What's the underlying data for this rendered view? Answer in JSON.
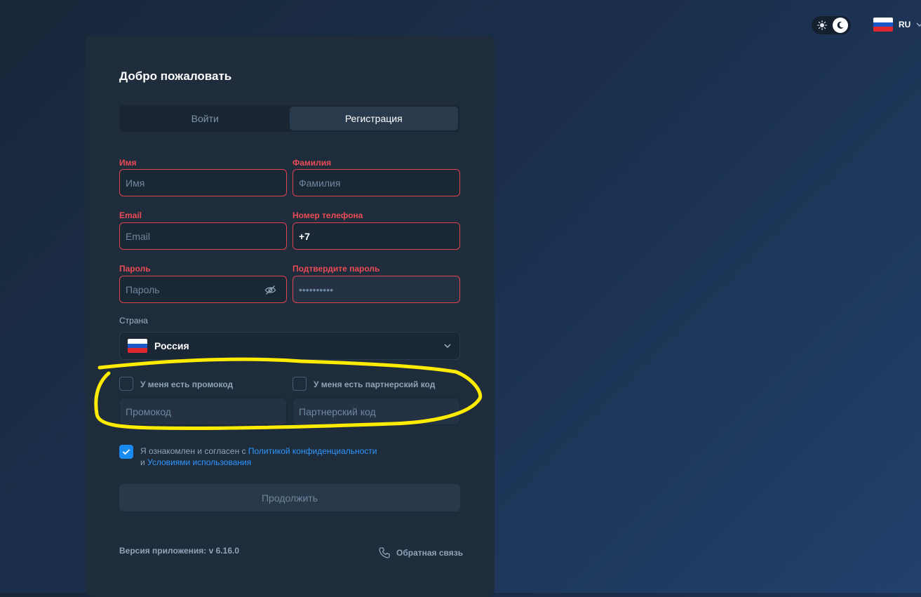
{
  "header": {
    "theme_toggle": {
      "light_icon": "sun-icon",
      "dark_icon": "moon-icon",
      "active": "dark"
    },
    "language": {
      "code": "RU",
      "flag": "russia-flag-icon"
    }
  },
  "form": {
    "title": "Добро пожаловать",
    "tabs": [
      {
        "label": "Войти",
        "active": false
      },
      {
        "label": "Регистрация",
        "active": true
      }
    ],
    "fields": {
      "first_name": {
        "label": "Имя",
        "placeholder": "Имя",
        "value": ""
      },
      "last_name": {
        "label": "Фамилия",
        "placeholder": "Фамилия",
        "value": ""
      },
      "email": {
        "label": "Email",
        "placeholder": "Email",
        "value": ""
      },
      "phone": {
        "label": "Номер телефона",
        "placeholder": "",
        "value": "+7"
      },
      "password": {
        "label": "Пароль",
        "placeholder": "Пароль",
        "value": ""
      },
      "password_confirm": {
        "label": "Подтвердите пароль",
        "placeholder": "••••••••••",
        "value": ""
      }
    },
    "country": {
      "label": "Страна",
      "value": "Россия",
      "flag": "russia-flag-icon"
    },
    "promo": {
      "checkbox_label": "У меня есть промокод",
      "placeholder": "Промокод",
      "checked": false
    },
    "partner": {
      "checkbox_label": "У меня есть партнерский код",
      "placeholder": "Партнерский код",
      "checked": false
    },
    "agreement": {
      "checked": true,
      "text_before": "Я ознакомлен и согласен с ",
      "privacy_link": "Политикой конфиденциальности",
      "and": "и ",
      "terms_link": "Условиями использования"
    },
    "submit_label": "Продолжить",
    "footer": {
      "version": "Версия приложения: v 6.16.0",
      "feedback": "Обратная связь"
    }
  },
  "colors": {
    "accent": "#1a8cf0",
    "error": "#e0444f",
    "annotation": "#ffec00"
  }
}
